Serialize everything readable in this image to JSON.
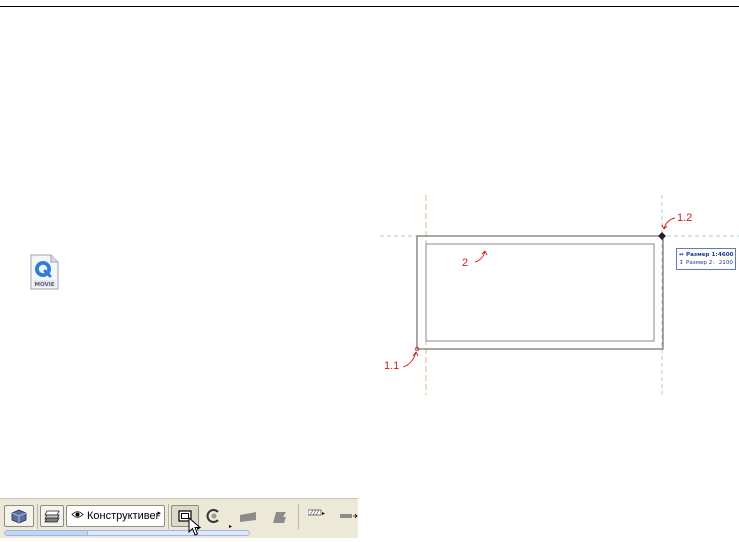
{
  "movie_file": {
    "caption": "MOVIE"
  },
  "drawing": {
    "callouts": {
      "p11": "1.1",
      "p12": "1.2",
      "p2": "2"
    },
    "dimensions": {
      "row1": {
        "label": "Размер 1:",
        "value": "4600"
      },
      "row2": {
        "label": "Размер 2:",
        "value": "2100"
      }
    },
    "colors": {
      "annotation": "#d21c1c",
      "guide": "#a8cde0",
      "wall": "#6e6e6e"
    }
  },
  "toolbar": {
    "layer_combo_label": "Конструктивен..."
  }
}
